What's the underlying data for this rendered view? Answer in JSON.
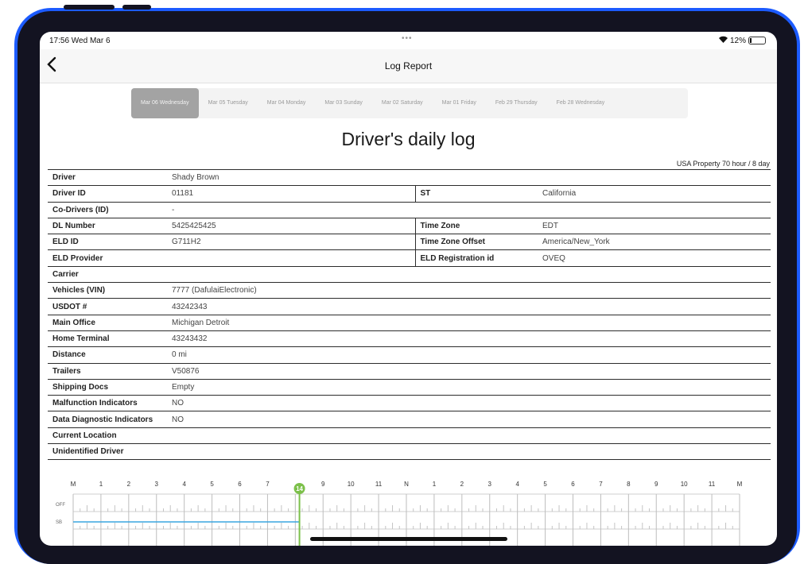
{
  "status": {
    "time": "17:56  Wed Mar 6",
    "battery": "12%"
  },
  "nav": {
    "title": "Log Report"
  },
  "dates": [
    "Mar 06 Wednesday",
    "Mar 05 Tuesday",
    "Mar 04 Monday",
    "Mar 03 Sunday",
    "Mar 02 Saturday",
    "Mar 01 Friday",
    "Feb 29 Thursday",
    "Feb 28 Wednesday"
  ],
  "heading": "Driver's daily log",
  "ruleset": "USA Property 70 hour / 8 day",
  "rows": [
    {
      "k": "Driver",
      "v": "Shady Brown"
    },
    {
      "k": "Driver ID",
      "v": "01181",
      "k2": "ST",
      "v2": "California"
    },
    {
      "k": "Co-Drivers (ID)",
      "v": "-"
    },
    {
      "k": "DL Number",
      "v": "5425425425",
      "k2": "Time Zone",
      "v2": "EDT"
    },
    {
      "k": "ELD ID",
      "v": "G711H2",
      "k2": "Time Zone Offset",
      "v2": "America/New_York"
    },
    {
      "k": "ELD Provider",
      "v": "",
      "k2": "ELD Registration id",
      "v2": "OVEQ"
    },
    {
      "k": "Carrier",
      "v": ""
    },
    {
      "k": "Vehicles (VIN)",
      "v": "7777 (DafulaiElectronic)"
    },
    {
      "k": "USDOT #",
      "v": "43242343"
    },
    {
      "k": "Main Office",
      "v": "Michigan Detroit"
    },
    {
      "k": "Home Terminal",
      "v": "43243432"
    },
    {
      "k": "Distance",
      "v": "0 mi"
    },
    {
      "k": "Trailers",
      "v": "V50876"
    },
    {
      "k": "Shipping Docs",
      "v": "Empty"
    },
    {
      "k": "Malfunction Indicators",
      "v": "NO"
    },
    {
      "k": "Data Diagnostic Indicators",
      "v": "NO"
    },
    {
      "k": "Current Location",
      "v": ""
    },
    {
      "k": "Unidentified Driver",
      "v": ""
    }
  ],
  "grid": {
    "hours": [
      "M",
      "1",
      "2",
      "3",
      "4",
      "5",
      "6",
      "7",
      "",
      "9",
      "10",
      "11",
      "N",
      "1",
      "2",
      "3",
      "4",
      "5",
      "6",
      "7",
      "8",
      "9",
      "10",
      "11",
      "M"
    ],
    "current_hour_label": "14",
    "row_labels": [
      "OFF",
      "SB"
    ],
    "current_hour": 8.15,
    "accent": "#7cc04a",
    "sb_line": "#3aa5e0"
  }
}
